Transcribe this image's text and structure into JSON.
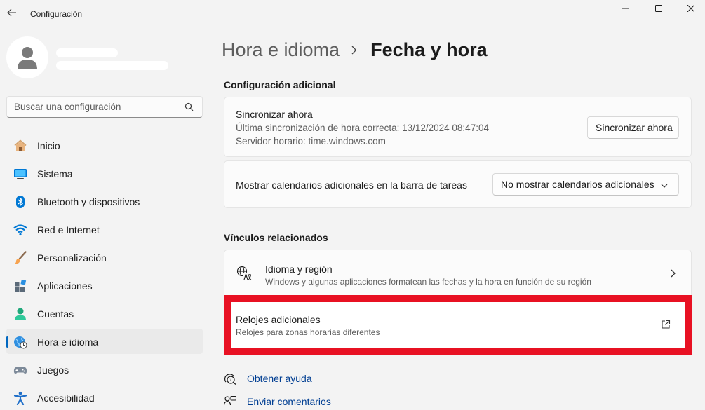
{
  "window": {
    "title": "Configuración",
    "back_icon": "back-arrow-icon",
    "controls": [
      "minimize-icon",
      "maximize-icon",
      "close-icon"
    ]
  },
  "search": {
    "placeholder": "Buscar una configuración",
    "icon": "search-icon"
  },
  "sidebar": {
    "items": [
      {
        "label": "Inicio",
        "icon": "home-icon"
      },
      {
        "label": "Sistema",
        "icon": "system-icon"
      },
      {
        "label": "Bluetooth y dispositivos",
        "icon": "bluetooth-icon"
      },
      {
        "label": "Red e Internet",
        "icon": "wifi-icon"
      },
      {
        "label": "Personalización",
        "icon": "brush-icon"
      },
      {
        "label": "Aplicaciones",
        "icon": "apps-icon"
      },
      {
        "label": "Cuentas",
        "icon": "accounts-icon"
      },
      {
        "label": "Hora e idioma",
        "icon": "time-language-icon",
        "active": true
      },
      {
        "label": "Juegos",
        "icon": "gamepad-icon"
      },
      {
        "label": "Accesibilidad",
        "icon": "accessibility-icon"
      }
    ]
  },
  "breadcrumb": {
    "parent": "Hora e idioma",
    "current": "Fecha y hora"
  },
  "additional_settings": {
    "title": "Configuración adicional",
    "sync": {
      "title": "Sincronizar ahora",
      "last_sync": "Última sincronización de hora correcta: 13/12/2024 08:47:04",
      "server": "Servidor horario: time.windows.com",
      "button": "Sincronizar ahora"
    },
    "calendars": {
      "label": "Mostrar calendarios adicionales en la barra de tareas",
      "selected": "No mostrar calendarios adicionales"
    }
  },
  "related_links": {
    "title": "Vínculos relacionados",
    "language_region": {
      "title": "Idioma y región",
      "description": "Windows y algunas aplicaciones formatean las fechas y la hora en función de su región",
      "icon": "language-icon"
    },
    "additional_clocks": {
      "title": "Relojes adicionales",
      "description": "Relojes para zonas horarias diferentes",
      "icon": "external-link-icon"
    }
  },
  "help": {
    "get_help": "Obtener ayuda",
    "feedback": "Enviar comentarios"
  },
  "colors": {
    "accent": "#0067c0",
    "highlight": "#e81123",
    "link": "#003e92"
  }
}
